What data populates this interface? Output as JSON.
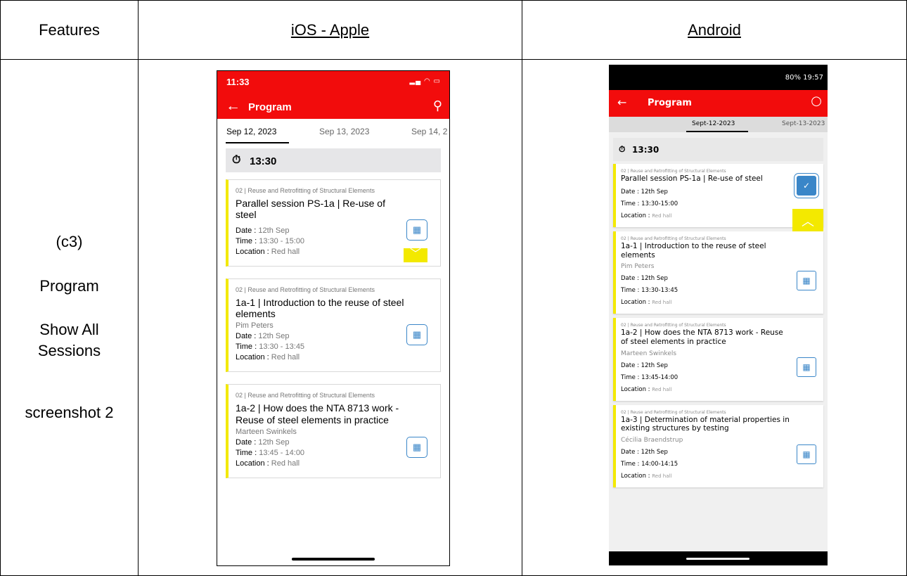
{
  "table": {
    "headers": [
      "Features",
      "iOS - Apple",
      "Android"
    ],
    "feature_lines": [
      "(c3)",
      "Program",
      "Show All",
      "Sessions",
      "screenshot 2"
    ]
  },
  "ios": {
    "status_time": "11:33",
    "title": "Program",
    "tabs": [
      "Sep 12, 2023",
      "Sep 13, 2023",
      "Sep 14, 2"
    ],
    "time_header": "13:30",
    "labels": {
      "date": "Date :",
      "time": "Time :",
      "location": "Location :"
    },
    "cards": [
      {
        "category": "02 | Reuse and Retrofitting of Structural Elements",
        "title": "Parallel session PS-1a | Re-use of steel",
        "speaker": "",
        "date": "12th Sep",
        "time": "13:30 - 15:00",
        "location": "Red hall"
      },
      {
        "category": "02 | Reuse and Retrofitting of Structural Elements",
        "title": "1a-1 | Introduction to the reuse of steel elements",
        "speaker": "Pim Peters",
        "date": "12th Sep",
        "time": "13:30 - 13:45",
        "location": "Red hall"
      },
      {
        "category": "02 | Reuse and Retrofitting of Structural Elements",
        "title": "1a-2 | How does the NTA 8713 work - Reuse of steel elements in practice",
        "speaker": "Marteen Swinkels",
        "date": "12th Sep",
        "time": "13:45 - 14:00",
        "location": "Red hall"
      }
    ]
  },
  "android": {
    "status": "80% 19:57",
    "title": "Program",
    "tabs": [
      "Sept-12-2023",
      "Sept-13-2023"
    ],
    "time_header": "13:30",
    "labels": {
      "date": "Date :",
      "time": "Time :",
      "location": "Location :"
    },
    "cards": [
      {
        "category": "02 | Reuse and Retrofitting of Structural Elements",
        "title": "Parallel session PS-1a | Re-use of steel",
        "speaker": "",
        "date": "12th Sep",
        "time": "13:30-15:00",
        "location": "Red hall"
      },
      {
        "category": "02 | Reuse and Retrofitting of Structural Elements",
        "title": "1a-1 | Introduction to the reuse of steel elements",
        "speaker": "Pim Peters",
        "date": "12th Sep",
        "time": "13:30-13:45",
        "location": "Red hall"
      },
      {
        "category": "02 | Reuse and Retrofitting of Structural Elements",
        "title": "1a-2 | How does the NTA 8713 work - Reuse of steel elements in practice",
        "speaker": "Marteen Swinkels",
        "date": "12th Sep",
        "time": "13:45-14:00",
        "location": "Red hall"
      },
      {
        "category": "02 | Reuse and Retrofitting of Structural Elements",
        "title": "1a-3 | Determination of material properties in existing structures by testing",
        "speaker": "Cécilia Braendstrup",
        "date": "12th Sep",
        "time": "14:00-14:15",
        "location": "Red hall"
      }
    ]
  },
  "colors": {
    "app_red": "#f20c0c",
    "accent_yellow": "#f3e900",
    "calendar_blue": "#3a86c8"
  },
  "icons": [
    "back-arrow-icon",
    "search-icon",
    "clock-icon",
    "calendar-icon",
    "chevron-down-icon",
    "chevron-up-icon"
  ]
}
